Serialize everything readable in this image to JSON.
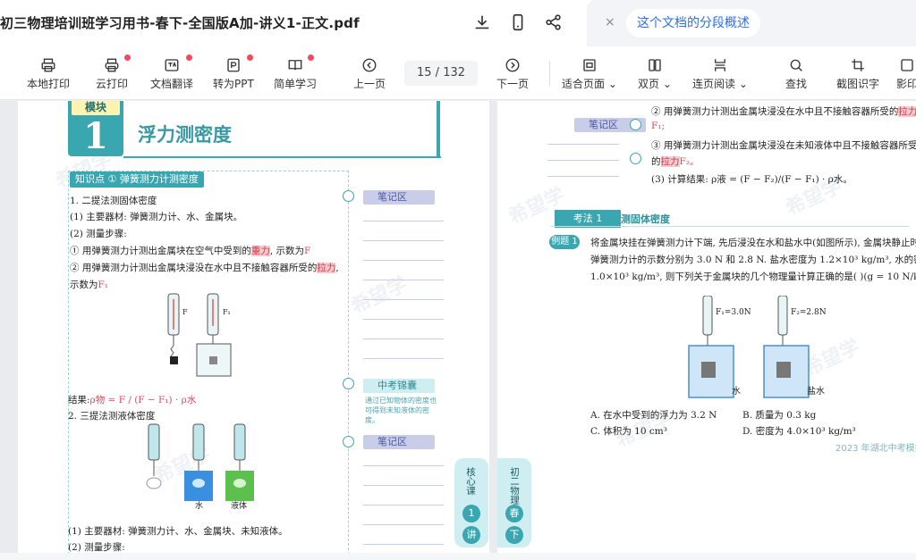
{
  "window": {
    "title": "初三物理培训班学习用书-春下-全国版A加-讲义1-正文.pdf",
    "ai_chip": "这个文档的分段概述",
    "ai_close": "×"
  },
  "toolbar": {
    "items": [
      {
        "label": "本地打印",
        "icon": "printer-icon",
        "dot": false
      },
      {
        "label": "云打印",
        "icon": "cloud-printer-icon",
        "dot": true
      },
      {
        "label": "文档翻译",
        "icon": "translate-icon",
        "dot": true
      },
      {
        "label": "转为PPT",
        "icon": "ppt-icon",
        "dot": true
      },
      {
        "label": "简单学习",
        "icon": "ai-book-icon",
        "dot": true
      },
      {
        "label": "上一页",
        "icon": "prev-page-icon",
        "dot": false
      },
      {
        "label": "下一页",
        "icon": "next-page-icon",
        "dot": false
      },
      {
        "label": "适合页面",
        "icon": "fit-page-icon",
        "dot": false,
        "dropdown": true
      },
      {
        "label": "双页",
        "icon": "double-page-icon",
        "dot": false,
        "dropdown": true
      },
      {
        "label": "连页阅读",
        "icon": "continuous-read-icon",
        "dot": false,
        "dropdown": true
      },
      {
        "label": "查找",
        "icon": "search-icon",
        "dot": false
      },
      {
        "label": "截图识字",
        "icon": "screenshot-ocr-icon",
        "dot": false
      },
      {
        "label": "影印",
        "icon": "more-icon",
        "dot": false
      }
    ],
    "page_current": "15",
    "page_total": "132",
    "page_sep": "/"
  },
  "left_page": {
    "module_label": "模块",
    "module_num": "1",
    "module_title": "浮力测密度",
    "kp_badge": "知识点 ① 弹簧测力计测密度",
    "lines": {
      "l1": "1. 二提法测固体密度",
      "l2": "(1) 主要器材: 弹簧测力计、水、金属块。",
      "l3": "(2) 测量步骤:",
      "l4a": "① 用弹簧测力计测出金属块在空气中受到的",
      "l4b": "重力",
      "l4c": ", 示数为",
      "l4d": "F",
      "l5a": "② 用弹簧测力计测出金属块浸没在水中且不接触容器所受的",
      "l5b": "拉力",
      "l5c": ",",
      "l6a": "示数为",
      "l6b": "F₁",
      "result_a": "结果:",
      "result_b": "ρ物 = F / (F − F₁) · ρ水",
      "l7": "2. 三提法测液体密度",
      "l8": "(1) 主要器材: 弹簧测力计、水、金属块、未知液体。",
      "l9": "(2) 测量步骤:",
      "fig_label_water": "水",
      "fig_label_liquid": "液体",
      "fig_label_f": "F",
      "fig_label_f1": "F₁",
      "fig_label_f2": "F₂"
    },
    "notes": {
      "head1": "笔记区",
      "head2": "中考锦囊",
      "tip": "通过已知物体的密度也可得到未知液体的密度。",
      "head3": "笔记区"
    },
    "side_tab": {
      "text": "核心课",
      "num": "1",
      "unit": "讲"
    },
    "watermark": "希望学"
  },
  "right_page": {
    "notes_head": "笔记区",
    "line_a1": "② 用弹簧测力计测出金属块浸没在水中且不接触容器所受的",
    "line_a2": "拉力",
    "line_a3": "F₁;",
    "line_b1": "③ 用弹簧测力计测出金属块浸没在未知液体中且不接触容器所受",
    "line_b2": "的",
    "line_b3": "拉力",
    "line_b4": "F₂。",
    "line_c": "(3) 计算结果: ρ液 = (F − F₂)/(F − F₁) · ρ水。",
    "kf_tag": "考法 1",
    "kf_sub": "测固体密度",
    "ex_tag": "例题 1",
    "q1": "将金属块挂在弹簧测力计下端, 先后浸没在水和盐水中(如图所示), 金属块静止时",
    "q2": "弹簧测力计的示数分别为 3.0 N 和 2.8 N. 盐水密度为 1.2×10³ kg/m³, 水的密度为",
    "q3": "1.0×10³ kg/m³, 则下列关于金属块的几个物理量计算正确的是(    )(g = 10 N/kg)",
    "fig_f1": "F₁=3.0N",
    "fig_f2": "F₂=2.8N",
    "fig_water": "水",
    "fig_salt": "盐水",
    "opt_a": "A. 在水中受到的浮力为 3.2 N",
    "opt_b": "B. 质量为 0.3 kg",
    "opt_c": "C. 体积为 10 cm³",
    "opt_d": "D. 密度为 4.0×10³ kg/m³",
    "source": "2023 年湖北中考模拟",
    "side_tab": {
      "text": "初二物理",
      "season": "春",
      "unit": "下"
    },
    "watermark": "希望学"
  },
  "colors": {
    "accent": "#3aa6b0",
    "red_dot": "#f24a5c",
    "highlight": "#f6c9cd",
    "link_blue": "#2f6fe4"
  }
}
